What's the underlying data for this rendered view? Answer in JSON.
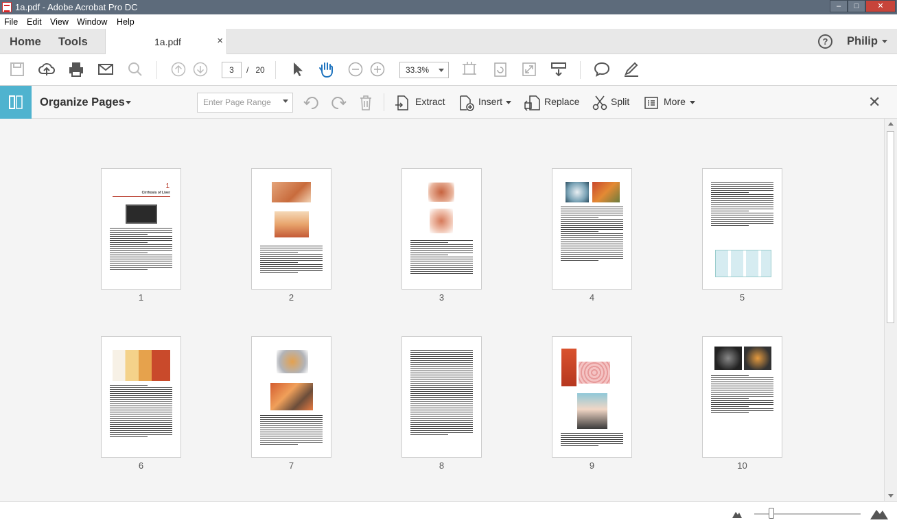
{
  "window": {
    "title": "1a.pdf - Adobe Acrobat Pro DC",
    "minimize": "–",
    "maximize": "□",
    "close": "✕"
  },
  "menu": [
    "File",
    "Edit",
    "View",
    "Window",
    "Help"
  ],
  "tabs": {
    "home": "Home",
    "tools": "Tools",
    "document": "1a.pdf",
    "close": "×"
  },
  "help_icon": "?",
  "user": "Philip",
  "toolbar": {
    "current_page": "3",
    "page_separator": "/",
    "total_pages": "20",
    "zoom": "33.3%",
    "icons": [
      "save-icon",
      "upload-icon",
      "print-icon",
      "email-icon",
      "search-icon",
      "prev-page-icon",
      "next-page-icon",
      "select-arrow-icon",
      "hand-icon",
      "zoom-out-icon",
      "zoom-in-icon",
      "fit-page-icon",
      "rotate-view-icon",
      "full-screen-icon",
      "scroll-mode-icon",
      "comment-icon",
      "sign-icon"
    ]
  },
  "organize": {
    "title": "Organize Pages",
    "range_placeholder": "Enter Page Range",
    "extract": "Extract",
    "insert": "Insert",
    "replace": "Replace",
    "split": "Split",
    "more": "More",
    "close": "✕"
  },
  "pages": [
    {
      "number": "1",
      "heading_num": "1",
      "heading": "Cirrhosis of Liver"
    },
    {
      "number": "2"
    },
    {
      "number": "3"
    },
    {
      "number": "4"
    },
    {
      "number": "5"
    },
    {
      "number": "6"
    },
    {
      "number": "7"
    },
    {
      "number": "8"
    },
    {
      "number": "9"
    },
    {
      "number": "10"
    }
  ],
  "colors": {
    "accent": "#4fb3cf",
    "titlebar": "#5d6b7b",
    "close_red": "#c7443a"
  }
}
